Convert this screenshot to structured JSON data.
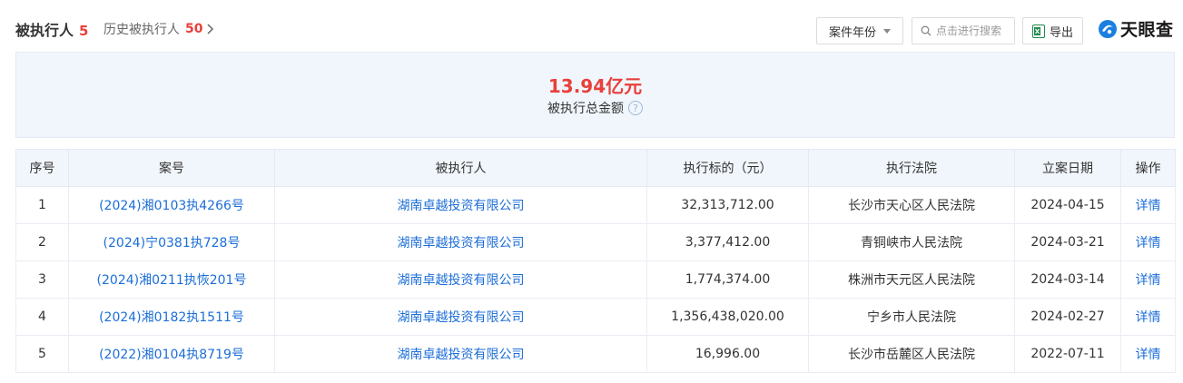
{
  "header": {
    "active_tab": {
      "label": "被执行人",
      "count": "5"
    },
    "history_tab": {
      "label": "历史被执行人",
      "count": "50"
    },
    "year_filter_label": "案件年份",
    "search_placeholder": "点击进行搜索",
    "export_label": "导出",
    "logo_text": "天眼查"
  },
  "summary": {
    "amount": "13.94亿元",
    "label": "被执行总金额",
    "help_glyph": "?"
  },
  "table": {
    "columns": [
      "序号",
      "案号",
      "被执行人",
      "执行标的（元）",
      "执行法院",
      "立案日期",
      "操作"
    ],
    "rows": [
      {
        "index": "1",
        "case_no": "(2024)湘0103执4266号",
        "party": "湖南卓越投资有限公司",
        "amount": "32,313,712.00",
        "court": "长沙市天心区人民法院",
        "date": "2024-04-15",
        "action": "详情"
      },
      {
        "index": "2",
        "case_no": "(2024)宁0381执728号",
        "party": "湖南卓越投资有限公司",
        "amount": "3,377,412.00",
        "court": "青铜峡市人民法院",
        "date": "2024-03-21",
        "action": "详情"
      },
      {
        "index": "3",
        "case_no": "(2024)湘0211执恢201号",
        "party": "湖南卓越投资有限公司",
        "amount": "1,774,374.00",
        "court": "株洲市天元区人民法院",
        "date": "2024-03-14",
        "action": "详情"
      },
      {
        "index": "4",
        "case_no": "(2024)湘0182执1511号",
        "party": "湖南卓越投资有限公司",
        "amount": "1,356,438,020.00",
        "court": "宁乡市人民法院",
        "date": "2024-02-27",
        "action": "详情"
      },
      {
        "index": "5",
        "case_no": "(2022)湘0104执8719号",
        "party": "湖南卓越投资有限公司",
        "amount": "16,996.00",
        "court": "长沙市岳麓区人民法院",
        "date": "2022-07-11",
        "action": "详情"
      }
    ]
  },
  "colors": {
    "accent_red": "#e8403c",
    "link_blue": "#1c6ed8",
    "panel_bg": "#f1f6fc",
    "excel_green": "#1e8a4c",
    "logo_blue": "#1b7fe0"
  },
  "icons": {
    "history_chevron": "chevron-right-icon",
    "year_caret": "caret-down-icon",
    "search": "search-icon",
    "export": "excel-icon",
    "logo_mark": "tianyancha-logo-icon",
    "help": "help-circle-icon"
  }
}
